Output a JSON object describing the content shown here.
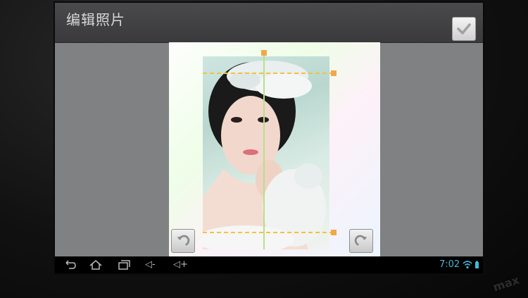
{
  "header": {
    "title": "编辑照片",
    "done_icon": "checkmark-icon"
  },
  "editor": {
    "rotate_left_icon": "rotate-left-icon",
    "rotate_right_icon": "rotate-right-icon"
  },
  "navbar": {
    "back_icon": "back-icon",
    "home_icon": "home-icon",
    "recents_icon": "recent-apps-icon",
    "volume_down_label": "◁-",
    "volume_up_label": "◁+",
    "clock": "7:02"
  },
  "device": {
    "logo": "max"
  },
  "colors": {
    "accent": "#43b9d9",
    "crop_guide": "#f2c23a",
    "crop_handle": "#f0a848",
    "vertical_guide": "#b7e08a"
  }
}
